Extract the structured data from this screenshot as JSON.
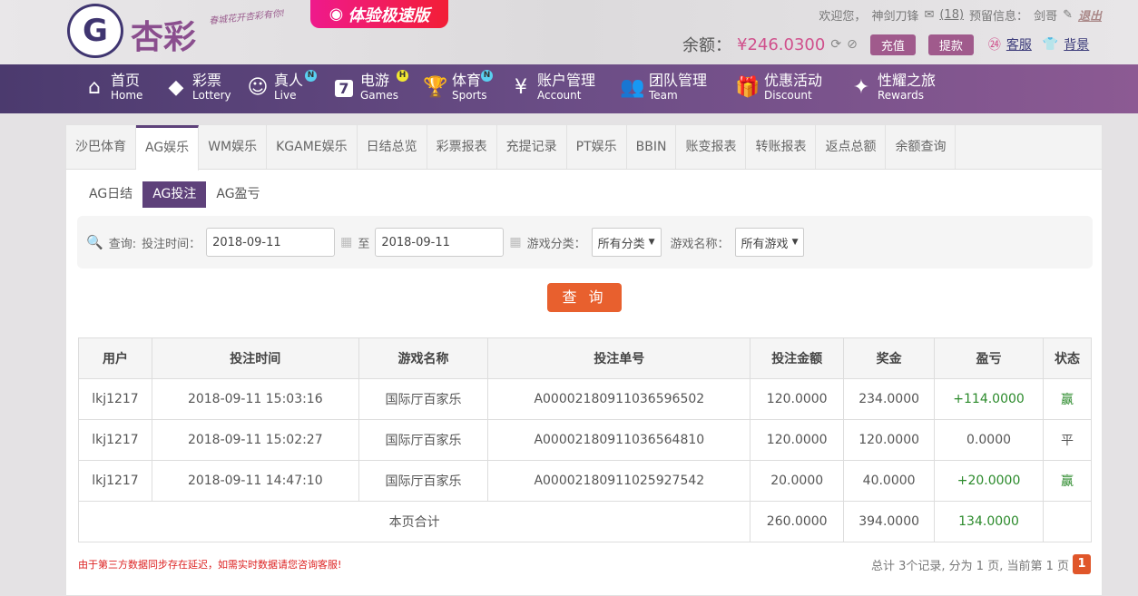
{
  "header": {
    "logo_text": "杏彩",
    "slogan": "春城花开杏彩有你!",
    "speed_button": "体验极速版",
    "welcome": "欢迎您，",
    "username": "神剑刀锋",
    "messages": "(18)",
    "reserved_label": "预留信息：",
    "reserved_value": "剑哥",
    "logout": "退出",
    "balance_label": "余额：",
    "balance_value": "¥246.0300",
    "deposit": "充值",
    "withdraw": "提款",
    "service": "客服",
    "background": "背景"
  },
  "nav": [
    {
      "cn": "首页",
      "en": "Home",
      "icon": "home-icon"
    },
    {
      "cn": "彩票",
      "en": "Lottery",
      "icon": "ticket-icon"
    },
    {
      "cn": "真人",
      "en": "Live",
      "icon": "woman-icon",
      "badge": "N"
    },
    {
      "cn": "电游",
      "en": "Games",
      "icon": "seven-icon",
      "badge": "H"
    },
    {
      "cn": "体育",
      "en": "Sports",
      "icon": "trophy-icon",
      "badge": "N"
    },
    {
      "cn": "账户管理",
      "en": "Account",
      "icon": "yen-icon"
    },
    {
      "cn": "团队管理",
      "en": "Team",
      "icon": "team-icon"
    },
    {
      "cn": "优惠活动",
      "en": "Discount",
      "icon": "gift-icon"
    },
    {
      "cn": "性耀之旅",
      "en": "Rewards",
      "icon": "rewards-icon"
    }
  ],
  "tabs": [
    "沙巴体育",
    "AG娱乐",
    "WM娱乐",
    "KGAME娱乐",
    "日结总览",
    "彩票报表",
    "充提记录",
    "PT娱乐",
    "BBIN",
    "账变报表",
    "转账报表",
    "返点总额",
    "余额查询"
  ],
  "subtabs": [
    "AG日结",
    "AG投注",
    "AG盈亏"
  ],
  "filter": {
    "query_label": "查询:",
    "time_label": "投注时间：",
    "start": "2018-09-11",
    "to": "至",
    "end": "2018-09-11",
    "category_label": "游戏分类：",
    "category_value": "所有分类",
    "game_label": "游戏名称：",
    "game_value": "所有游戏",
    "submit": "查 询"
  },
  "table": {
    "headers": [
      "用户",
      "投注时间",
      "游戏名称",
      "投注单号",
      "投注金额",
      "奖金",
      "盈亏",
      "状态"
    ],
    "rows": [
      [
        "lkj1217",
        "2018-09-11 15:03:16",
        "国际厅百家乐",
        "A00002180911036596502",
        "120.0000",
        "234.0000",
        "+114.0000",
        "赢"
      ],
      [
        "lkj1217",
        "2018-09-11 15:02:27",
        "国际厅百家乐",
        "A00002180911036564810",
        "120.0000",
        "120.0000",
        "0.0000",
        "平"
      ],
      [
        "lkj1217",
        "2018-09-11 14:47:10",
        "国际厅百家乐",
        "A00002180911025927542",
        "20.0000",
        "40.0000",
        "+20.0000",
        "赢"
      ]
    ],
    "total": {
      "label": "本页合计",
      "bet": "260.0000",
      "prize": "394.0000",
      "profit": "134.0000"
    }
  },
  "note": "由于第三方数据同步存在延迟，如需实时数据请您咨询客服!",
  "pager": {
    "summary": "总计 3个记录, 分为 1 页, 当前第 1 页",
    "page": "1"
  }
}
